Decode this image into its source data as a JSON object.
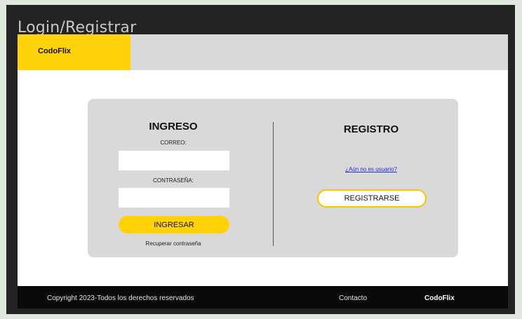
{
  "window": {
    "title": "Login/Registrar"
  },
  "navbar": {
    "brand": "CodoFlix"
  },
  "login": {
    "heading": "INGRESO",
    "email_label": "CORREO:",
    "email_value": "",
    "password_label": "CONTRASEÑA:",
    "password_value": "",
    "submit_label": "INGRESAR",
    "recover_label": "Recuperar contraseña"
  },
  "register": {
    "heading": "REGISTRO",
    "not_user_link": "¿Aún no es usuario?",
    "register_button": "REGISTRARSE"
  },
  "footer": {
    "copyright": "Copyright 2023-Todos los derechos reservados",
    "contact": "Contacto",
    "brand": "CodoFlix"
  },
  "colors": {
    "accent": "#ffd20a",
    "nav_bg": "#d9d9d9",
    "footer_bg": "#0a0a0a",
    "link": "#1a2fd1"
  }
}
